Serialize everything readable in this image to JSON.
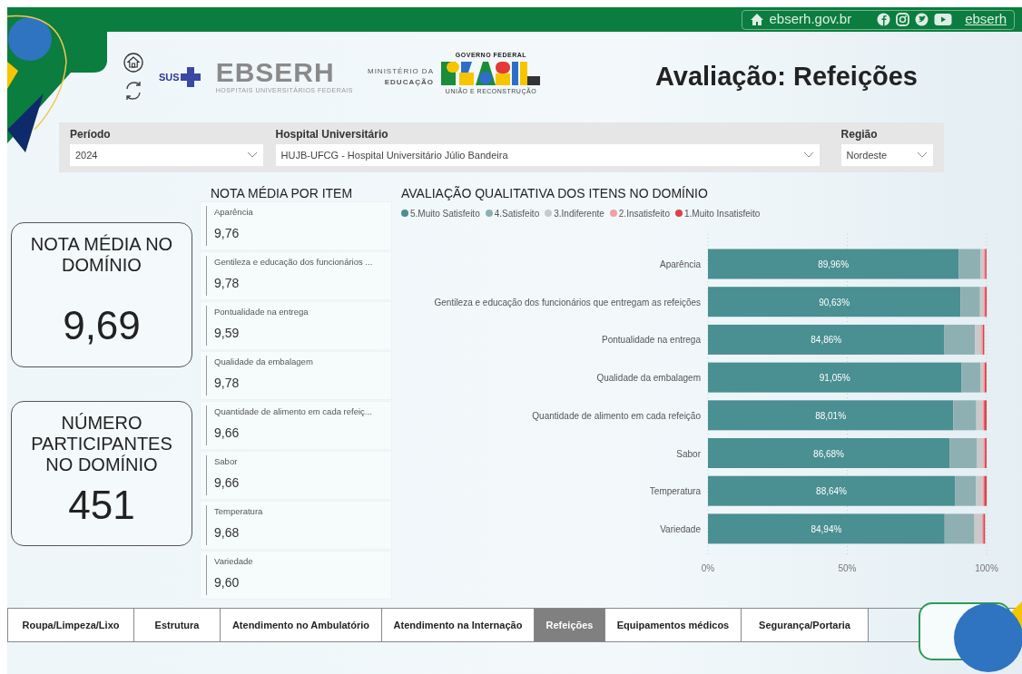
{
  "top_bar": {
    "site_link": "ebserh.gov.br",
    "social_handle": "ebserh"
  },
  "header": {
    "sus_label": "SUS",
    "ebserh_name": "EBSERH",
    "ebserh_subtitle": "HOSPITAIS UNIVERSITÁRIOS FEDERAIS",
    "ministry_line_1": "MINISTÉRIO DA",
    "ministry_line_2": "EDUCAÇÃO",
    "government_label": "GOVERNO FEDERAL",
    "government_slogan": "UNIÃO E RECONSTRUÇÃO",
    "title": "Avaliação: Refeições"
  },
  "filters": [
    {
      "label": "Período",
      "value": "2024"
    },
    {
      "label": "Hospital Universitário",
      "value": "HUJB-UFCG - Hospital Universitário Júlio Bandeira"
    },
    {
      "label": "Região",
      "value": "Nordeste"
    }
  ],
  "kpis": [
    {
      "label": "NOTA MÉDIA NO DOMÍNIO",
      "value": "9,69"
    },
    {
      "label": "NÚMERO PARTICIPANTES NO DOMÍNIO",
      "value": "451"
    }
  ],
  "item_scores": {
    "title": "NOTA MÉDIA POR ITEM",
    "items": [
      {
        "name": "Aparência",
        "score": "9,76"
      },
      {
        "name": "Gentileza e educação dos funcionários ...",
        "score": "9,78"
      },
      {
        "name": "Pontualidade na entrega",
        "score": "9,59"
      },
      {
        "name": "Qualidade da embalagem",
        "score": "9,78"
      },
      {
        "name": "Quantidade de alimento em cada refeiç...",
        "score": "9,66"
      },
      {
        "name": "Sabor",
        "score": "9,66"
      },
      {
        "name": "Temperatura",
        "score": "9,68"
      },
      {
        "name": "Variedade",
        "score": "9,60"
      }
    ]
  },
  "qualitative": {
    "title": "AVALIAÇÃO QUALITATIVA DOS ITENS NO DOMÍNIO",
    "chart_data": {
      "type": "bar",
      "orientation": "horizontal",
      "stacked": true,
      "categories": [
        "Aparência",
        "Gentileza e educação dos funcionários que entregam as refeições",
        "Pontualidade na entrega",
        "Qualidade da embalagem",
        "Quantidade de alimento em cada refeição",
        "Sabor",
        "Temperatura",
        "Variedade"
      ],
      "series": [
        {
          "name": "5.Muito Satisfeito",
          "color": "#4a8f92",
          "values": [
            89.96,
            90.63,
            84.86,
            91.05,
            88.01,
            86.68,
            88.64,
            84.94
          ]
        },
        {
          "name": "4.Satisfeito",
          "color": "#8fb0b2",
          "values": [
            7.9,
            7.0,
            11.0,
            6.8,
            8.3,
            9.9,
            7.6,
            10.7
          ]
        },
        {
          "name": "3.Indiferente",
          "color": "#c9c9c9",
          "values": [
            1.0,
            1.2,
            2.2,
            0.9,
            2.2,
            2.2,
            2.3,
            2.6
          ]
        },
        {
          "name": "2.Insatisfeito",
          "color": "#f0a0a8",
          "values": [
            0.6,
            0.6,
            0.6,
            0.6,
            0.6,
            0.6,
            0.6,
            0.6
          ]
        },
        {
          "name": "1.Muito Insatisfeito",
          "color": "#d9434f",
          "values": [
            0.5,
            0.6,
            0.5,
            0.6,
            0.9,
            0.6,
            0.9,
            0.6
          ]
        }
      ],
      "value_labels": [
        "89,96%",
        "90,63%",
        "84,86%",
        "91,05%",
        "88,01%",
        "86,68%",
        "88,64%",
        "84,94%"
      ],
      "xlim": [
        0,
        100
      ],
      "xticks": [
        {
          "value": 0,
          "label": "0%"
        },
        {
          "value": 50,
          "label": "50%"
        },
        {
          "value": 100,
          "label": "100%"
        }
      ]
    }
  },
  "tabs": [
    {
      "label": "Roupa/Limpeza/Lixo",
      "selected": false
    },
    {
      "label": "Estrutura",
      "selected": false
    },
    {
      "label": "Atendimento no Ambulatório",
      "selected": false
    },
    {
      "label": "Atendimento na Internação",
      "selected": false
    },
    {
      "label": "Refeições",
      "selected": true
    },
    {
      "label": "Equipamentos médicos",
      "selected": false
    },
    {
      "label": "Segurança/Portaria",
      "selected": false
    }
  ]
}
